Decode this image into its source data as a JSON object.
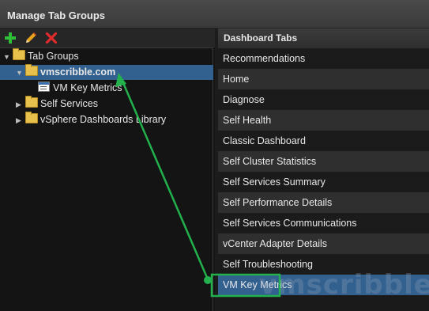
{
  "window": {
    "title": "Manage Tab Groups"
  },
  "toolbar": {
    "add_icon": "plus-icon",
    "edit_icon": "pencil-icon",
    "delete_icon": "x-icon"
  },
  "tree": {
    "root": "Tab Groups",
    "selected_group": "vmscribble.com",
    "child": "VM Key Metrics",
    "group2": "Self Services",
    "group3": "vSphere Dashboards Library"
  },
  "dashboard_tabs": {
    "header": "Dashboard Tabs",
    "items": [
      "Recommendations",
      "Home",
      "Diagnose",
      "Self Health",
      "Classic Dashboard",
      "Self Cluster Statistics",
      "Self Services Summary",
      "Self Performance Details",
      "Self Services Communications",
      "vCenter Adapter Details",
      "Self Troubleshooting",
      "VM Key Metrics"
    ],
    "selected_index": 11
  },
  "watermark": "vmscribble",
  "colors": {
    "selection": "#33618f",
    "annotation": "#22b14c",
    "folder": "#e7c14b"
  }
}
